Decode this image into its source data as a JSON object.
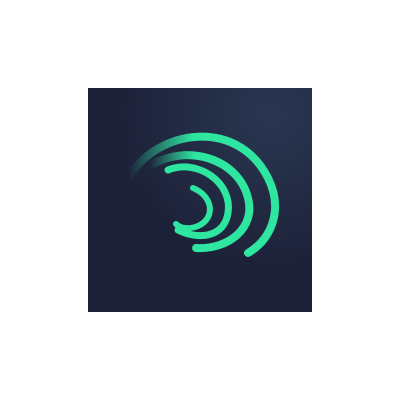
{
  "icon": {
    "name": "app-logo-icon",
    "colors": {
      "page_background": "#ffffff",
      "tile_background": "#1c2138",
      "tile_highlight": "#2a3752",
      "arc_accent": "#2ee6a0"
    }
  }
}
